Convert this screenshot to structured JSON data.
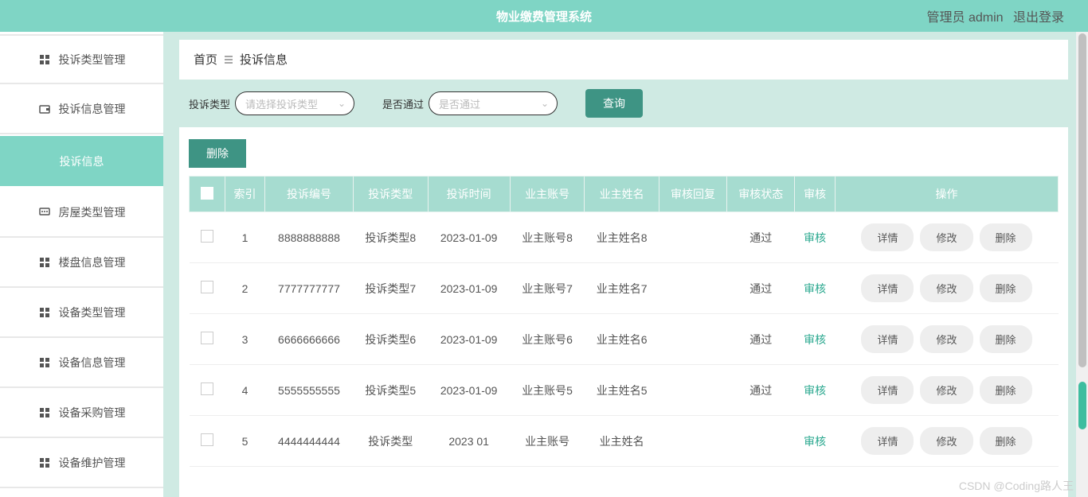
{
  "header": {
    "title": "物业缴费管理系统",
    "user_label": "管理员 admin",
    "logout": "退出登录"
  },
  "sidebar": {
    "items": [
      {
        "label": "投诉类型管理",
        "icon": "grid"
      },
      {
        "label": "投诉信息管理",
        "icon": "wallet"
      },
      {
        "label": "投诉信息",
        "icon": "",
        "active": true
      },
      {
        "label": "房屋类型管理",
        "icon": "chat"
      },
      {
        "label": "楼盘信息管理",
        "icon": "grid"
      },
      {
        "label": "设备类型管理",
        "icon": "grid"
      },
      {
        "label": "设备信息管理",
        "icon": "grid"
      },
      {
        "label": "设备采购管理",
        "icon": "grid"
      },
      {
        "label": "设备维护管理",
        "icon": "grid"
      }
    ]
  },
  "breadcrumb": {
    "home": "首页",
    "current": "投诉信息"
  },
  "filters": {
    "type_label": "投诉类型",
    "type_placeholder": "请选择投诉类型",
    "pass_label": "是否通过",
    "pass_placeholder": "是否通过",
    "query_btn": "查询",
    "delete_btn": "删除"
  },
  "table": {
    "headers": [
      "",
      "索引",
      "投诉编号",
      "投诉类型",
      "投诉时间",
      "业主账号",
      "业主姓名",
      "审核回复",
      "审核状态",
      "审核",
      "操作"
    ],
    "audit_link": "审核",
    "op_detail": "详情",
    "op_edit": "修改",
    "op_delete": "删除",
    "rows": [
      {
        "idx": "1",
        "no": "8888888888",
        "type": "投诉类型8",
        "time": "2023-01-09",
        "acct": "业主账号8",
        "name": "业主姓名8",
        "reply": "",
        "status": "通过"
      },
      {
        "idx": "2",
        "no": "7777777777",
        "type": "投诉类型7",
        "time": "2023-01-09",
        "acct": "业主账号7",
        "name": "业主姓名7",
        "reply": "",
        "status": "通过"
      },
      {
        "idx": "3",
        "no": "6666666666",
        "type": "投诉类型6",
        "time": "2023-01-09",
        "acct": "业主账号6",
        "name": "业主姓名6",
        "reply": "",
        "status": "通过"
      },
      {
        "idx": "4",
        "no": "5555555555",
        "type": "投诉类型5",
        "time": "2023-01-09",
        "acct": "业主账号5",
        "name": "业主姓名5",
        "reply": "",
        "status": "通过"
      },
      {
        "idx": "5",
        "no": "4444444444",
        "type": "投诉类型",
        "time": "2023 01",
        "acct": "业主账号",
        "name": "业主姓名",
        "reply": "",
        "status": ""
      }
    ]
  },
  "watermark": "CSDN @Coding路人王"
}
